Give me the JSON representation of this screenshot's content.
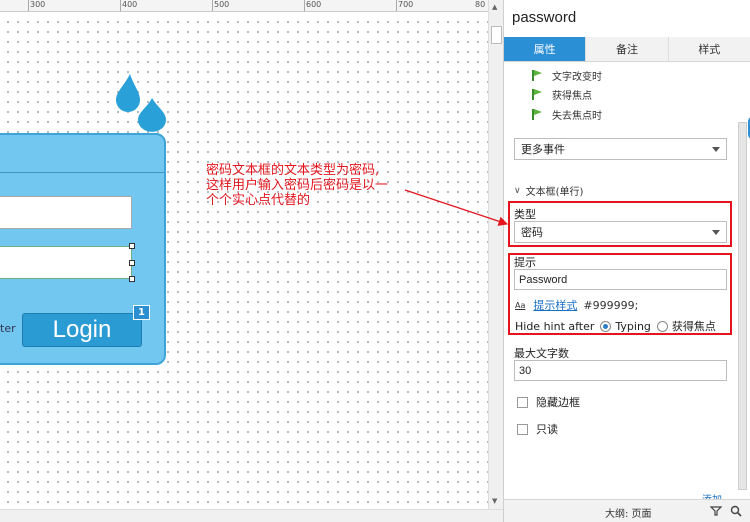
{
  "ruler": {
    "ticks": [
      "300",
      "400",
      "500",
      "600",
      "700",
      "80"
    ]
  },
  "canvas": {
    "login_label": "Login",
    "badge_number": "1",
    "partial_label": "ter",
    "annotation": {
      "line1": "密码文本框的文本类型为密码,",
      "line2": "这样用户输入密码后密码是以一",
      "line3": "个个实心点代替的"
    }
  },
  "panel": {
    "title": "password",
    "tabs": [
      {
        "label": "属性",
        "active": true
      },
      {
        "label": "备注",
        "active": false
      },
      {
        "label": "样式",
        "active": false
      }
    ],
    "events": [
      "文字改变时",
      "获得焦点",
      "失去焦点时"
    ],
    "more_events_value": "更多事件",
    "section_title": "文本框(单行)",
    "type_label": "类型",
    "type_value": "密码",
    "hint_label": "提示",
    "hint_value": "Password",
    "hint_style_aa": "Aa",
    "hint_style_link": "提示样式",
    "hint_style_color": "#999999;",
    "hide_hint_label": "Hide hint after",
    "hide_hint_options": [
      "Typing",
      "获得焦点"
    ],
    "hide_hint_selected": "Typing",
    "max_length_label": "最大文字数",
    "max_length_value": "30",
    "hide_border_label": "隐藏边框",
    "readonly_label": "只读",
    "partial_link": "添加",
    "bottom_outline_label": "大纲: 页面"
  },
  "colors": {
    "accent": "#2b8fd6",
    "annotation_red": "#e3161d",
    "widget_blue": "#71c7f0",
    "button_blue": "#2a9bd3"
  },
  "icons": [
    "event-flag-icon",
    "filter-icon",
    "search-icon",
    "chevron-down-icon",
    "water-drop-icon"
  ]
}
